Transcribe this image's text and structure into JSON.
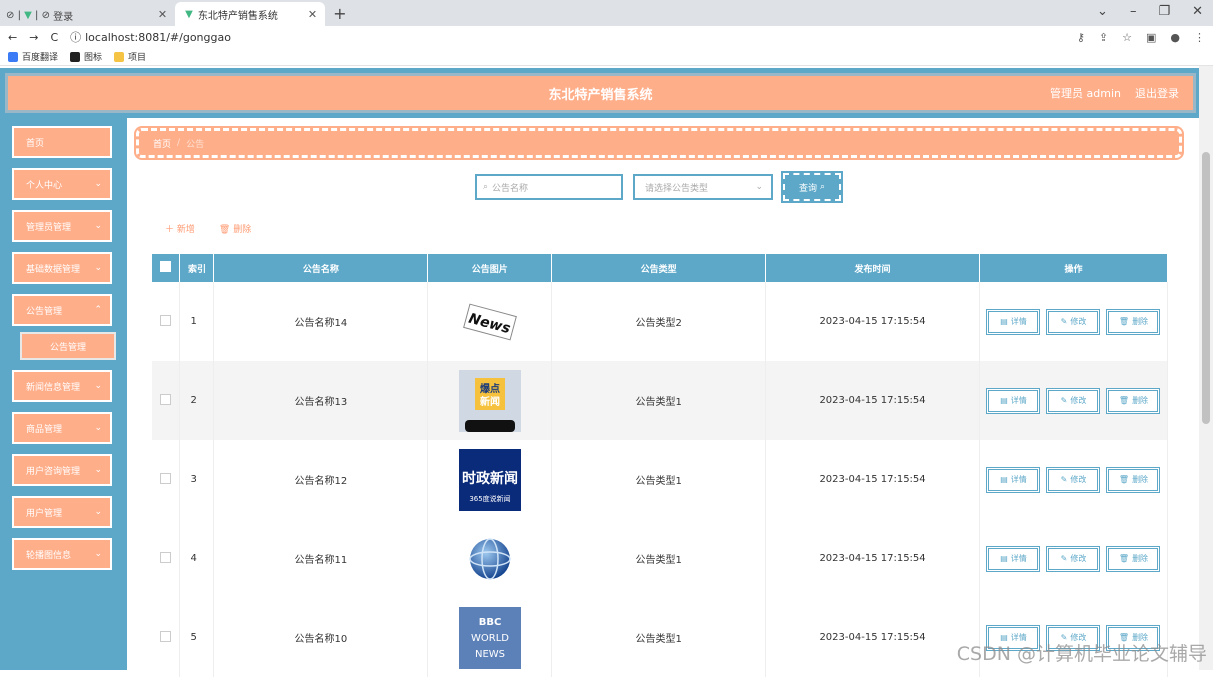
{
  "browser": {
    "tabs": [
      {
        "label": "登录"
      },
      {
        "label": "东北特产销售系统"
      }
    ],
    "url": "localhost:8081/#/gonggao",
    "bookmarks": [
      "百度翻译",
      "图标",
      "项目"
    ]
  },
  "header": {
    "title": "东北特产销售系统",
    "user": "管理员 admin",
    "logout": "退出登录"
  },
  "sidebar": {
    "items": [
      {
        "label": "首页",
        "has_children": false
      },
      {
        "label": "个人中心",
        "has_children": true
      },
      {
        "label": "管理员管理",
        "has_children": true
      },
      {
        "label": "基础数据管理",
        "has_children": true
      },
      {
        "label": "公告管理",
        "has_children": true
      },
      {
        "label": "新闻信息管理",
        "has_children": true
      },
      {
        "label": "商品管理",
        "has_children": true
      },
      {
        "label": "用户咨询管理",
        "has_children": true
      },
      {
        "label": "用户管理",
        "has_children": true
      },
      {
        "label": "轮播图信息",
        "has_children": true
      }
    ],
    "submenu": {
      "label": "公告管理"
    }
  },
  "breadcrumb": {
    "home": "首页",
    "separator": "/",
    "current": "公告"
  },
  "search": {
    "name_placeholder": "公告名称",
    "type_placeholder": "请选择公告类型",
    "query_label": "查询"
  },
  "actions": {
    "add_label": "新增",
    "delete_label": "删除"
  },
  "table": {
    "columns": [
      "索引",
      "公告名称",
      "公告图片",
      "公告类型",
      "发布时间",
      "操作"
    ],
    "rows": [
      {
        "index": "1",
        "name": "公告名称14",
        "image": "news-newspaper",
        "type": "公告类型2",
        "time": "2023-04-15 17:15:54"
      },
      {
        "index": "2",
        "name": "公告名称13",
        "image": "hot-news-phone",
        "type": "公告类型1",
        "time": "2023-04-15 17:15:54"
      },
      {
        "index": "3",
        "name": "公告名称12",
        "image": "politics-news",
        "type": "公告类型1",
        "time": "2023-04-15 17:15:54"
      },
      {
        "index": "4",
        "name": "公告名称11",
        "image": "news-globe",
        "type": "公告类型1",
        "time": "2023-04-15 17:15:54"
      },
      {
        "index": "5",
        "name": "公告名称10",
        "image": "bbc-world-news",
        "type": "公告类型1",
        "time": "2023-04-15 17:15:54"
      }
    ],
    "image_text": {
      "news": "News",
      "hot": "爆点",
      "hot2": "新闻",
      "politics": "时政新闻",
      "politics_sub": "365度说新闻",
      "bbc": "BBC",
      "world": "WORLD",
      "news_word": "NEWS"
    },
    "op_labels": {
      "detail": "详情",
      "edit": "修改",
      "delete": "删除"
    }
  },
  "watermark": "CSDN @计算机毕业论文辅导",
  "colors": {
    "primary": "#5da8c9",
    "accent": "#ffae8a"
  }
}
